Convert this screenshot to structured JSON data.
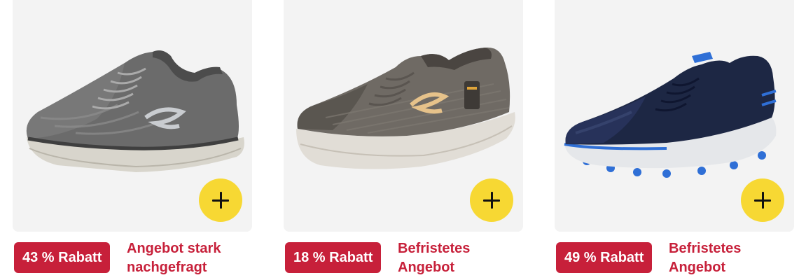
{
  "products": [
    {
      "discount": "43 % Rabatt",
      "deal_line1": "Angebot stark",
      "deal_line2": "nachgefragt",
      "image": "grey-knit-slip-on-sneaker",
      "add_icon": "plus-icon"
    },
    {
      "discount": "18 % Rabatt",
      "deal_line1": "Befristetes",
      "deal_line2": "Angebot",
      "image": "grey-mesh-walking-sneaker",
      "add_icon": "plus-icon"
    },
    {
      "discount": "49 % Rabatt",
      "deal_line1": "Befristetes",
      "deal_line2": "Angebot",
      "image": "navy-golf-shoe",
      "add_icon": "plus-icon"
    }
  ],
  "colors": {
    "badge_red": "#c7203a",
    "add_button_yellow": "#f7d833",
    "image_background": "#f3f3f3"
  }
}
